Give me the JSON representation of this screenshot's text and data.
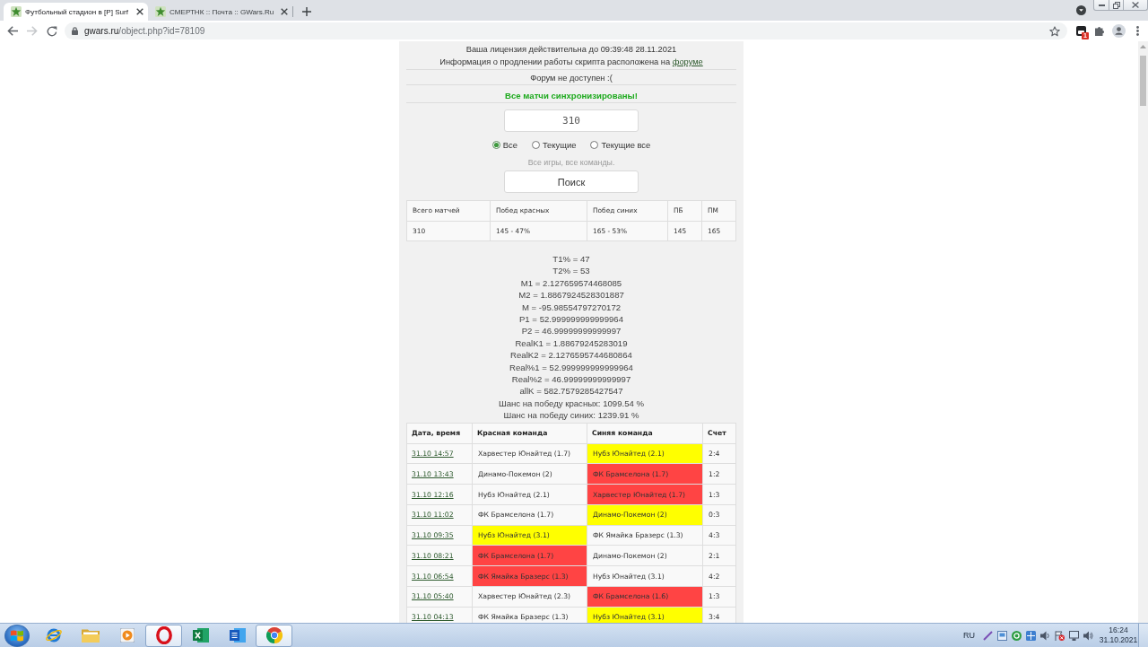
{
  "browser": {
    "tabs": [
      {
        "title": "Футбольный стадион в [P] Surf",
        "selected": true
      },
      {
        "title": "СМЕРТНК :: Почта :: GWars.Ru",
        "selected": false
      }
    ],
    "nav_buttons": [
      {
        "kind": "back",
        "disabled": false
      },
      {
        "kind": "forward",
        "disabled": true
      },
      {
        "kind": "reload",
        "disabled": false
      }
    ],
    "address": {
      "host": "gwars.ru",
      "path": "/object.php?id=78109"
    },
    "extension_badge": "1"
  },
  "page": {
    "license": "Ваша лицензия действительна до 09:39:48 28.11.2021",
    "renewal_info": {
      "text": "Информация о продлении работы скрипта расположена на",
      "link": "форуме"
    },
    "forum_status": "Форум не доступен :(",
    "sync_status": "Все матчи синхронизированы!",
    "count_field": {
      "value": "310"
    },
    "filters": [
      {
        "label": "Все",
        "selected": true
      },
      {
        "label": "Текущие",
        "selected": false
      },
      {
        "label": "Текущие все",
        "selected": false
      }
    ],
    "filter_hint": "Все игры, все команды.",
    "search_button": "Поиск",
    "summary": {
      "columns": [
        "Всего матчей",
        "Побед красных",
        "Побед синих",
        "ПБ",
        "ПМ"
      ],
      "values": [
        "310",
        "145 - 47%",
        "165 - 53%",
        "145",
        "165"
      ]
    },
    "stats_lines": [
      "T1% = 47",
      "T2% = 53",
      "M1 = 2.127659574468085",
      "M2 = 1.8867924528301887",
      "M = -95.98554797270172",
      "P1 = 52.999999999999964",
      "P2 = 46.99999999999997",
      "RealK1 = 1.88679245283019",
      "RealK2 = 2.1276595744680864",
      "Real%1 = 52.999999999999964",
      "Real%2 = 46.99999999999997",
      "allK = 582.7579285427547",
      "Шанс на победу красных: 1099.54 %",
      "Шанс на победу синих: 1239.91 %"
    ],
    "matches": {
      "columns": [
        "Дата, время",
        "Красная команда",
        "Синяя команда",
        "Счет"
      ],
      "rows": [
        {
          "datetime": "31.10 14:57",
          "red": {
            "team": "Харвестер Юнайтед (1.7)"
          },
          "blue": {
            "team": "Нубз Юнайтед (2.1)",
            "color": "#ffff00"
          },
          "score": "2:4"
        },
        {
          "datetime": "31.10 13:43",
          "red": {
            "team": "Динамо-Покемон (2)"
          },
          "blue": {
            "team": "ФК Брамселона (1.7)",
            "color": "#ff4444"
          },
          "score": "1:2"
        },
        {
          "datetime": "31.10 12:16",
          "red": {
            "team": "Нубз Юнайтед (2.1)"
          },
          "blue": {
            "team": "Харвестер Юнайтед (1.7)",
            "color": "#ff4444"
          },
          "score": "1:3"
        },
        {
          "datetime": "31.10 11:02",
          "red": {
            "team": "ФК Брамселона (1.7)"
          },
          "blue": {
            "team": "Динамо-Покемон (2)",
            "color": "#ffff00"
          },
          "score": "0:3"
        },
        {
          "datetime": "31.10 09:35",
          "red": {
            "team": "Нубз Юнайтед (3.1)",
            "color": "#ffff00"
          },
          "blue": {
            "team": "ФК Ямайка Бразерс (1.3)"
          },
          "score": "4:3"
        },
        {
          "datetime": "31.10 08:21",
          "red": {
            "team": "ФК Брамселона (1.7)",
            "color": "#ff4444"
          },
          "blue": {
            "team": "Динамо-Покемон (2)"
          },
          "score": "2:1"
        },
        {
          "datetime": "31.10 06:54",
          "red": {
            "team": "ФК Ямайка Бразерс (1.3)",
            "color": "#ff4444"
          },
          "blue": {
            "team": "Нубз Юнайтед (3.1)"
          },
          "score": "4:2"
        },
        {
          "datetime": "31.10 05:40",
          "red": {
            "team": "Харвестер Юнайтед (2.3)"
          },
          "blue": {
            "team": "ФК Брамселона (1.6)",
            "color": "#ff4444"
          },
          "score": "1:3"
        },
        {
          "datetime": "31.10 04:13",
          "red": {
            "team": "ФК Ямайка Бразерс (1.3)"
          },
          "blue": {
            "team": "Нубз Юнайтед (3.1)",
            "color": "#ffff00"
          },
          "score": "3:4"
        }
      ]
    }
  },
  "taskbar": {
    "buttons": [
      {
        "kind": "ie",
        "running": false
      },
      {
        "kind": "folder",
        "running": false
      },
      {
        "kind": "media",
        "running": false
      },
      {
        "kind": "opera",
        "running": true
      },
      {
        "kind": "excel",
        "running": false
      },
      {
        "kind": "word",
        "running": false
      },
      {
        "kind": "chrome",
        "running": true
      }
    ],
    "language": "RU",
    "time": "16:24",
    "date": "31.10.2021"
  }
}
